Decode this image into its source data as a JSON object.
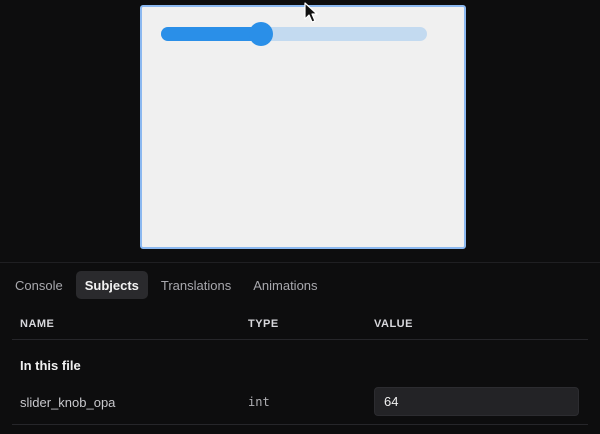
{
  "preview": {
    "slider": {
      "value_fraction": 0.375,
      "accent_color": "#2a8fe8",
      "track_color": "#c3daf0"
    }
  },
  "tabs": [
    {
      "label": "Console",
      "active": false
    },
    {
      "label": "Subjects",
      "active": true
    },
    {
      "label": "Translations",
      "active": false
    },
    {
      "label": "Animations",
      "active": false
    }
  ],
  "table": {
    "columns": {
      "name": "NAME",
      "type": "TYPE",
      "value": "VALUE"
    },
    "section_title": "In this file",
    "rows": [
      {
        "name": "slider_knob_opa",
        "type": "int",
        "value": "64"
      }
    ]
  }
}
